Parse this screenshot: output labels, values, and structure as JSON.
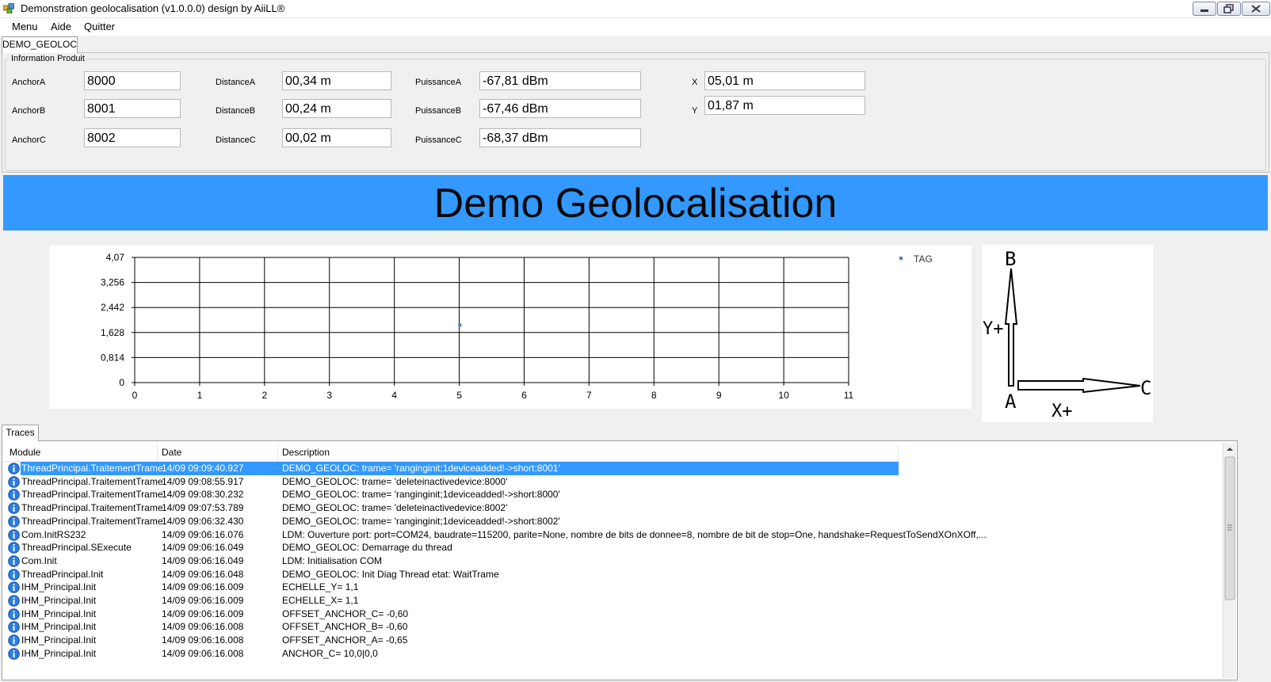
{
  "window": {
    "title": "Demonstration geolocalisation (v1.0.0.0) design by AiiLL®"
  },
  "menu": [
    {
      "label": "Menu"
    },
    {
      "label": "Aide"
    },
    {
      "label": "Quitter"
    }
  ],
  "tabs": {
    "main": "DEMO_GEOLOC",
    "traces": "Traces"
  },
  "product_info": {
    "legend": "Information Produit",
    "anchorA": {
      "label": "AnchorA",
      "value": "8000"
    },
    "anchorB": {
      "label": "AnchorB",
      "value": "8001"
    },
    "anchorC": {
      "label": "AnchorC",
      "value": "8002"
    },
    "distanceA": {
      "label": "DistanceA",
      "value": "00,34 m"
    },
    "distanceB": {
      "label": "DistanceB",
      "value": "00,24 m"
    },
    "distanceC": {
      "label": "DistanceC",
      "value": "00,02 m"
    },
    "puissanceA": {
      "label": "PuissanceA",
      "value": "-67,81 dBm"
    },
    "puissanceB": {
      "label": "PuissanceB",
      "value": "-67,46 dBm"
    },
    "puissanceC": {
      "label": "PuissanceC",
      "value": "-68,37 dBm"
    },
    "x": {
      "label": "X",
      "value": "05,01 m"
    },
    "y": {
      "label": "Y",
      "value": "01,87 m"
    }
  },
  "banner": {
    "text": "Demo Geolocalisation",
    "color": "#3399ff"
  },
  "chart_data": {
    "type": "scatter",
    "title": "",
    "xlabel": "",
    "ylabel": "",
    "xlim": [
      0,
      11
    ],
    "ylim": [
      0,
      4.07
    ],
    "x_ticks": [
      0,
      1,
      2,
      3,
      4,
      5,
      6,
      7,
      8,
      9,
      10,
      11
    ],
    "y_ticks": [
      0,
      0.814,
      1.628,
      2.442,
      3.256,
      4.07
    ],
    "x_tick_labels": [
      "0",
      "1",
      "2",
      "3",
      "4",
      "5",
      "6",
      "7",
      "8",
      "9",
      "10",
      "11"
    ],
    "y_tick_labels": [
      "0",
      "0,814",
      "1,628",
      "2,442",
      "3,256",
      "4,07"
    ],
    "grid": true,
    "legend_position": "top-right",
    "series": [
      {
        "name": "TAG",
        "color": "#4f81bd",
        "points": [
          {
            "x": 5.01,
            "y": 1.87
          }
        ]
      }
    ]
  },
  "axes_diagram": {
    "label_b": "B",
    "label_a": "A",
    "label_c": "C",
    "label_y": "Y+",
    "label_x": "X+"
  },
  "traces": {
    "columns": [
      "Module",
      "Date",
      "Description"
    ],
    "selected_index": 0,
    "rows": [
      {
        "module": "ThreadPrincipal.TraitementTrame",
        "date": "14/09 09:09:40.927",
        "description": "DEMO_GEOLOC: trame= 'ranginginit;1deviceadded!->short:8001'"
      },
      {
        "module": "ThreadPrincipal.TraitementTrame",
        "date": "14/09 09:08:55.917",
        "description": "DEMO_GEOLOC: trame= 'deleteinactivedevice:8000'"
      },
      {
        "module": "ThreadPrincipal.TraitementTrame",
        "date": "14/09 09:08:30.232",
        "description": "DEMO_GEOLOC: trame= 'ranginginit;1deviceadded!->short:8000'"
      },
      {
        "module": "ThreadPrincipal.TraitementTrame",
        "date": "14/09 09:07:53.789",
        "description": "DEMO_GEOLOC: trame= 'deleteinactivedevice:8002'"
      },
      {
        "module": "ThreadPrincipal.TraitementTrame",
        "date": "14/09 09:06:32.430",
        "description": "DEMO_GEOLOC: trame= 'ranginginit;1deviceadded!->short:8002'"
      },
      {
        "module": "Com.InitRS232",
        "date": "14/09 09:06:16.076",
        "description": "LDM: Ouverture port: port=COM24, baudrate=115200, parite=None, nombre de bits de donnee=8, nombre de bit de stop=One, handshake=RequestToSendXOnXOff,..."
      },
      {
        "module": "ThreadPrincipal.SExecute",
        "date": "14/09 09:06:16.049",
        "description": "DEMO_GEOLOC: Demarrage du thread"
      },
      {
        "module": "Com.Init",
        "date": "14/09 09:06:16.049",
        "description": "LDM: Initialisation COM"
      },
      {
        "module": "ThreadPrincipal.Init",
        "date": "14/09 09:06:16.048",
        "description": "DEMO_GEOLOC: Init Diag Thread etat: WaitTrame"
      },
      {
        "module": "IHM_Principal.Init",
        "date": "14/09 09:06:16.009",
        "description": "ECHELLE_Y= 1,1"
      },
      {
        "module": "IHM_Principal.Init",
        "date": "14/09 09:06:16.009",
        "description": "ECHELLE_X= 1,1"
      },
      {
        "module": "IHM_Principal.Init",
        "date": "14/09 09:06:16.009",
        "description": "OFFSET_ANCHOR_C= -0,60"
      },
      {
        "module": "IHM_Principal.Init",
        "date": "14/09 09:06:16.008",
        "description": "OFFSET_ANCHOR_B= -0,60"
      },
      {
        "module": "IHM_Principal.Init",
        "date": "14/09 09:06:16.008",
        "description": "OFFSET_ANCHOR_A= -0,65"
      },
      {
        "module": "IHM_Principal.Init",
        "date": "14/09 09:06:16.008",
        "description": "ANCHOR_C= 10,0|0,0"
      }
    ]
  }
}
